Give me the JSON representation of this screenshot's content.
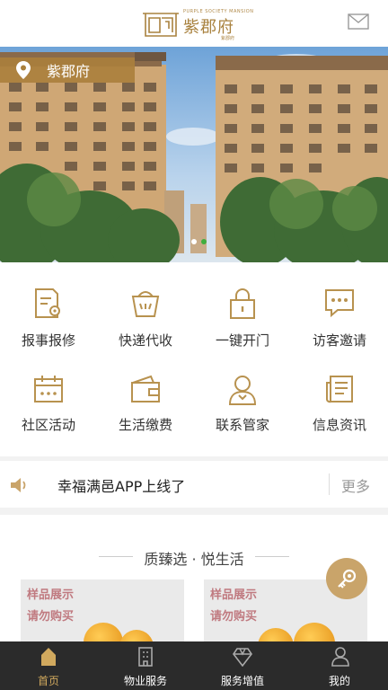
{
  "header": {
    "logo_en": "PURPLE SOCIETY MANSION",
    "logo_cn": "紫郡府",
    "logo_sub": "紫郡府"
  },
  "banner": {
    "location_label": "紫郡府",
    "active_slide": 1,
    "slide_count": 2
  },
  "services": [
    {
      "label": "报事报修",
      "icon": "repair-document-gear-icon"
    },
    {
      "label": "快递代收",
      "icon": "express-basket-icon"
    },
    {
      "label": "一键开门",
      "icon": "lock-icon"
    },
    {
      "label": "访客邀请",
      "icon": "chat-bubble-icon"
    },
    {
      "label": "社区活动",
      "icon": "calendar-icon"
    },
    {
      "label": "生活缴费",
      "icon": "wallet-icon"
    },
    {
      "label": "联系管家",
      "icon": "butler-icon"
    },
    {
      "label": "信息资讯",
      "icon": "news-icon"
    }
  ],
  "notice": {
    "text": "幸福满邑APP上线了",
    "more": "更多"
  },
  "selection": {
    "title": "质臻选 · 悦生活",
    "cards": [
      {
        "line1": "样品展示",
        "line2": "请勿购买"
      },
      {
        "line1": "样品展示",
        "line2": "请勿购买"
      }
    ]
  },
  "tabbar": {
    "tabs": [
      {
        "label": "首页",
        "active": true,
        "icon": "home-icon"
      },
      {
        "label": "物业服务",
        "active": false,
        "icon": "building-icon"
      },
      {
        "label": "服务增值",
        "active": false,
        "icon": "diamond-icon"
      },
      {
        "label": "我的",
        "active": false,
        "icon": "user-icon"
      }
    ]
  },
  "colors": {
    "accent": "#c9a46a",
    "tabbar_bg": "#2b2b2b",
    "tab_active": "#d1a95e"
  }
}
